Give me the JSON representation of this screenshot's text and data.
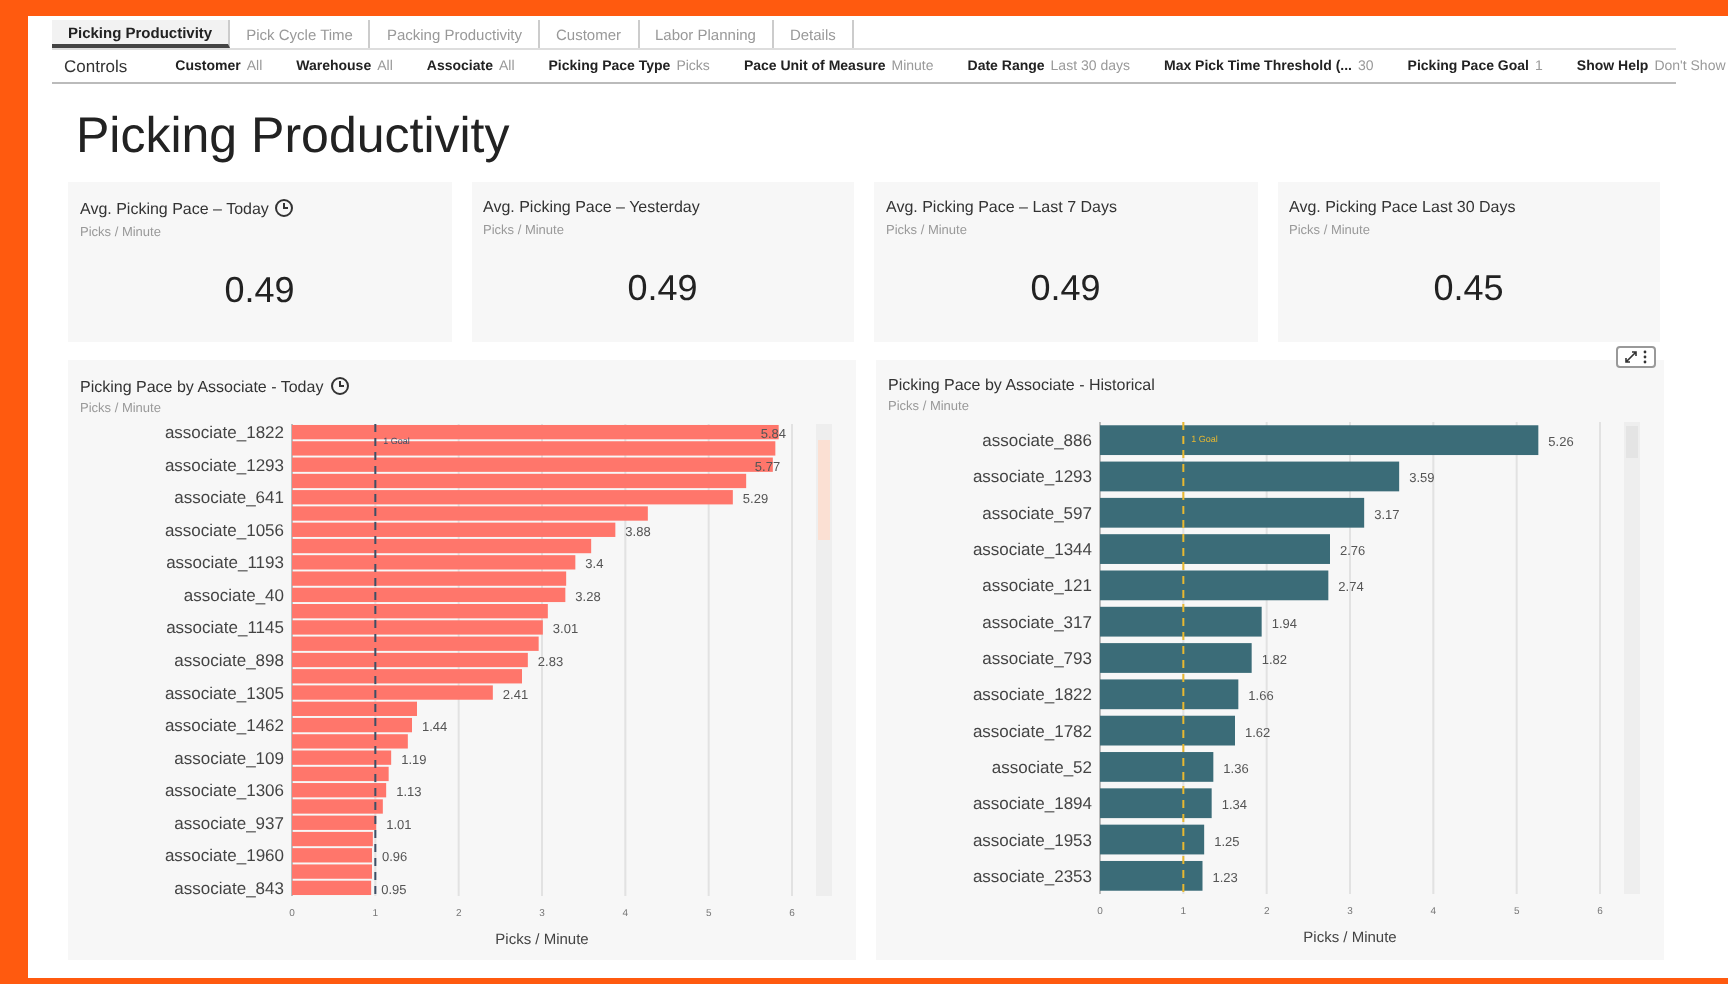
{
  "tabs": [
    {
      "label": "Picking Productivity",
      "selected": true
    },
    {
      "label": "Pick Cycle Time",
      "selected": false
    },
    {
      "label": "Packing Productivity",
      "selected": false
    },
    {
      "label": "Customer",
      "selected": false
    },
    {
      "label": "Labor Planning",
      "selected": false
    },
    {
      "label": "Details",
      "selected": false
    }
  ],
  "controls": {
    "label": "Controls",
    "filters": [
      {
        "name": "Customer",
        "value": "All"
      },
      {
        "name": "Warehouse",
        "value": "All"
      },
      {
        "name": "Associate",
        "value": "All"
      },
      {
        "name": "Picking Pace Type",
        "value": "Picks"
      },
      {
        "name": "Pace Unit of Measure",
        "value": "Minute"
      },
      {
        "name": "Date Range",
        "value": "Last 30 days"
      },
      {
        "name": "Max Pick Time Threshold (...",
        "value": "30"
      },
      {
        "name": "Picking Pace Goal",
        "value": "1"
      },
      {
        "name": "Show Help",
        "value": "Don't Show"
      }
    ]
  },
  "title": "Picking Productivity",
  "kpis": [
    {
      "title": "Avg. Picking Pace – Today",
      "subtitle": "Picks / Minute",
      "value": "0.49",
      "clock_icon": true
    },
    {
      "title": "Avg. Picking Pace – Yesterday",
      "subtitle": "Picks / Minute",
      "value": "0.49",
      "clock_icon": false
    },
    {
      "title": "Avg. Picking Pace – Last 7 Days",
      "subtitle": "Picks / Minute",
      "value": "0.49",
      "clock_icon": false
    },
    {
      "title": "Avg. Picking Pace Last 30 Days",
      "subtitle": "Picks / Minute",
      "value": "0.45",
      "clock_icon": false
    }
  ],
  "charts": [
    {
      "title": "Picking Pace by Associate - Today",
      "subtitle": "Picks / Minute",
      "clock_icon": true,
      "toolbar": false,
      "chart_data": {
        "type": "bar",
        "orientation": "horizontal",
        "xlabel": "Picks / Minute",
        "grid": true,
        "categories": [
          "associate_1822",
          "associate_1293",
          "associate_641",
          "associate_1056",
          "associate_1193",
          "associate_40",
          "associate_1145",
          "associate_898",
          "associate_1305",
          "associate_1462",
          "associate_109",
          "associate_1306",
          "associate_937",
          "associate_1960",
          "associate_843"
        ],
        "series": [
          {
            "color": "#ff766b",
            "values": [
              5.84,
              5.77,
              5.29,
              3.88,
              3.4,
              3.28,
              3.01,
              2.83,
              2.41,
              1.44,
              1.19,
              1.13,
              1.01,
              0.96,
              0.95
            ]
          },
          {
            "color": "#ff766b",
            "data_labels": false,
            "values": [
              5.8,
              5.45,
              4.27,
              3.59,
              3.29,
              3.07,
              2.96,
              2.76,
              1.5,
              1.39,
              1.16,
              1.09,
              0.97,
              0.96,
              null
            ]
          }
        ],
        "xlim": [
          0,
          6
        ],
        "xticks": [
          0,
          1,
          2,
          3,
          4,
          5,
          6
        ],
        "data_labels": true,
        "ref_lines": [
          {
            "axis": "x",
            "value": 1,
            "label": "1 Goal",
            "color": "#3d4f66"
          }
        ]
      }
    },
    {
      "title": "Picking Pace by Associate - Historical",
      "subtitle": "Picks / Minute",
      "clock_icon": false,
      "toolbar": true,
      "chart_data": {
        "type": "bar",
        "orientation": "horizontal",
        "xlabel": "Picks / Minute",
        "grid": true,
        "categories": [
          "associate_886",
          "associate_1293",
          "associate_597",
          "associate_1344",
          "associate_121",
          "associate_317",
          "associate_793",
          "associate_1822",
          "associate_1782",
          "associate_52",
          "associate_1894",
          "associate_1953",
          "associate_2353"
        ],
        "series": [
          {
            "color": "#3b6c78",
            "values": [
              5.26,
              3.59,
              3.17,
              2.76,
              2.74,
              1.94,
              1.82,
              1.66,
              1.62,
              1.36,
              1.34,
              1.25,
              1.23
            ]
          }
        ],
        "xlim": [
          0,
          6
        ],
        "xticks": [
          0,
          1,
          2,
          3,
          4,
          5,
          6
        ],
        "data_labels": true,
        "ref_lines": [
          {
            "axis": "x",
            "value": 1,
            "label": "1 Goal",
            "color": "#e8b830"
          }
        ]
      }
    }
  ]
}
